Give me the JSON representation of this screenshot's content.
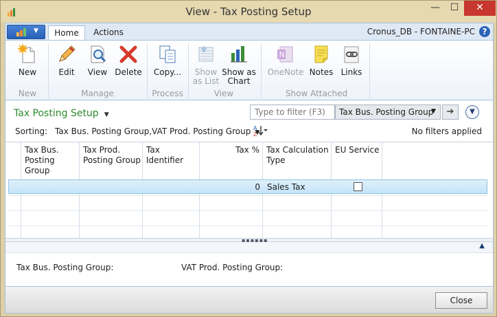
{
  "window": {
    "title": "View - Tax Posting Setup",
    "min_glyph": "—",
    "max_glyph": "☐",
    "close_glyph": "✕"
  },
  "ribbon": {
    "tabs": [
      {
        "label": "Home",
        "active": true
      },
      {
        "label": "Actions",
        "active": false
      }
    ],
    "company": "Cronus_DB - FONTAINE-PC",
    "help_glyph": "?",
    "buttons": {
      "new": "New",
      "edit": "Edit",
      "view": "View",
      "delete": "Delete",
      "copy": "Copy...",
      "show_as_list": "Show as List",
      "show_as_chart": "Show as Chart",
      "onenote": "OneNote",
      "notes": "Notes",
      "links": "Links"
    },
    "groups": {
      "new": "New",
      "manage": "Manage",
      "process": "Process",
      "view": "View",
      "show_attached": "Show Attached"
    }
  },
  "page": {
    "title": "Tax Posting Setup",
    "filter_placeholder": "Type to filter (F3)",
    "filter_field": "Tax Bus. Posting Group",
    "sorting_label": "Sorting:",
    "sorting_value": "Tax Bus. Posting Group,VAT Prod. Posting Group",
    "filters_status": "No filters applied"
  },
  "grid": {
    "columns": [
      "Tax Bus. Posting Group",
      "Tax Prod. Posting Group",
      "Tax Identifier",
      "Tax %",
      "Tax Calculation Type",
      "EU Service"
    ],
    "rows": [
      {
        "tax_bus": "",
        "tax_prod": "",
        "tax_identifier": "",
        "tax_pct": "0",
        "calc_type": "Sales Tax",
        "eu_service": false
      }
    ]
  },
  "factbox": {
    "field1": "Tax Bus. Posting Group:",
    "field2": "VAT Prod. Posting Group:"
  },
  "footer": {
    "close_label": "Close"
  },
  "colors": {
    "accent": "#2d8a2d",
    "selection": "#c5e4f8",
    "title_close": "#c7372f"
  }
}
